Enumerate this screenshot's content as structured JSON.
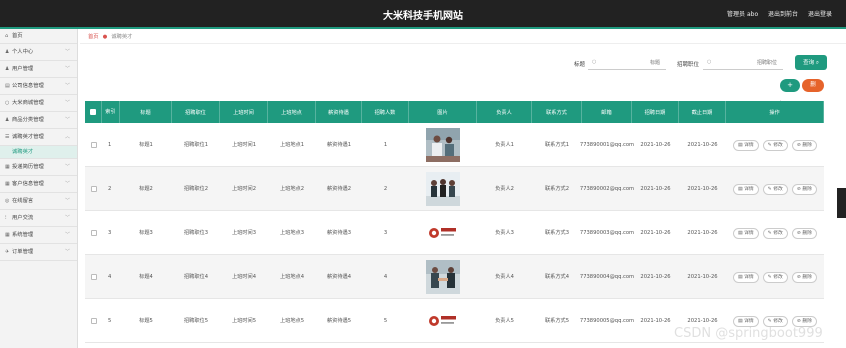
{
  "header": {
    "title": "大米科技手机网站",
    "admin": "管理员 abo",
    "back": "退出到前台",
    "logout": "退出登录"
  },
  "sidebar": {
    "home": "首页",
    "items": [
      {
        "label": "个人中心",
        "icon": "user-icon"
      },
      {
        "label": "用户管理",
        "icon": "users-icon"
      },
      {
        "label": "公司信息管理",
        "icon": "company-icon"
      },
      {
        "label": "大米商城管理",
        "icon": "shop-icon"
      },
      {
        "label": "商品分类管理",
        "icon": "category-icon"
      },
      {
        "label": "诚聘英才管理",
        "icon": "recruit-icon"
      },
      {
        "label": "投递简历管理",
        "icon": "resume-icon"
      },
      {
        "label": "客户信息管理",
        "icon": "client-icon"
      },
      {
        "label": "在线留言",
        "icon": "message-icon"
      },
      {
        "label": "用户交流",
        "icon": "chat-icon"
      },
      {
        "label": "系统管理",
        "icon": "system-icon"
      },
      {
        "label": "订单管理",
        "icon": "order-icon"
      }
    ],
    "sub_active": "诚聘英才"
  },
  "breadcrumb": {
    "home": "首页",
    "current": "诚聘英才"
  },
  "search": {
    "label1": "标题",
    "placeholder1": "标题",
    "label2": "招聘职位",
    "placeholder2": "招聘职位",
    "button": "查询"
  },
  "actions": {
    "add": "+",
    "delete": "删"
  },
  "table": {
    "headers": [
      "索引",
      "标题",
      "招聘职位",
      "上班时间",
      "上班地点",
      "薪资待遇",
      "招聘人数",
      "图片",
      "负责人",
      "联系方式",
      "邮箱",
      "招聘日期",
      "截止日期",
      "操作"
    ],
    "ops": [
      "详情",
      "修改",
      "删除"
    ],
    "rows": [
      {
        "idx": "1",
        "title": "标题1",
        "pos": "招聘职位1",
        "time": "上班时间1",
        "place": "上班地点1",
        "pay": "薪资待遇1",
        "count": "1",
        "contact": "负责人1",
        "phone": "联系方式1",
        "email": "773890001@qq.com",
        "date": "2021-10-26",
        "end": "2021-10-26",
        "img": "office"
      },
      {
        "idx": "2",
        "title": "标题2",
        "pos": "招聘职位2",
        "time": "上班时间2",
        "place": "上班地点2",
        "pay": "薪资待遇2",
        "count": "2",
        "contact": "负责人2",
        "phone": "联系方式2",
        "email": "773890002@qq.com",
        "date": "2021-10-26",
        "end": "2021-10-26",
        "img": "team"
      },
      {
        "idx": "3",
        "title": "标题3",
        "pos": "招聘职位3",
        "time": "上班时间3",
        "place": "上班地点3",
        "pay": "薪资待遇3",
        "count": "3",
        "contact": "负责人3",
        "phone": "联系方式3",
        "email": "773890003@qq.com",
        "date": "2021-10-26",
        "end": "2021-10-26",
        "img": "logo"
      },
      {
        "idx": "4",
        "title": "标题4",
        "pos": "招聘职位4",
        "time": "上班时间4",
        "place": "上班地点4",
        "pay": "薪资待遇4",
        "count": "4",
        "contact": "负责人4",
        "phone": "联系方式4",
        "email": "773890004@qq.com",
        "date": "2021-10-26",
        "end": "2021-10-26",
        "img": "handshake"
      },
      {
        "idx": "5",
        "title": "标题5",
        "pos": "招聘职位5",
        "time": "上班时间5",
        "place": "上班地点5",
        "pay": "薪资待遇5",
        "count": "5",
        "contact": "负责人5",
        "phone": "联系方式5",
        "email": "773890005@qq.com",
        "date": "2021-10-26",
        "end": "2021-10-26",
        "img": "logo"
      }
    ]
  },
  "watermark": "CSDN @springboot999",
  "colors": {
    "accent": "#1f9a7f",
    "danger": "#e6632b",
    "header": "#222222"
  }
}
